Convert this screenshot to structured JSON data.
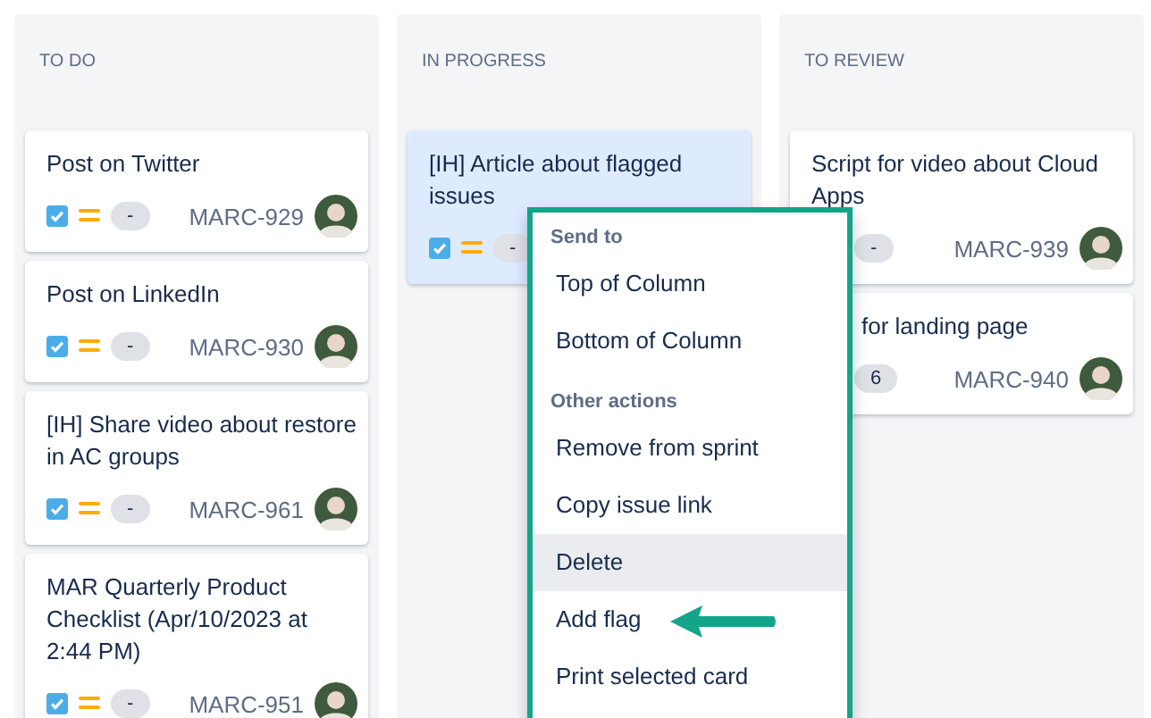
{
  "columns": [
    {
      "title": "TO DO",
      "cards": [
        {
          "title": "Post on Twitter",
          "done": true,
          "estimate": "-",
          "key": "MARC-929",
          "avatar": true,
          "selected": false
        },
        {
          "title": "Post on LinkedIn",
          "done": true,
          "estimate": "-",
          "key": "MARC-930",
          "avatar": true,
          "selected": false
        },
        {
          "title": "[IH] Share video about restore in AC groups",
          "done": true,
          "estimate": "-",
          "key": "MARC-961",
          "avatar": true,
          "selected": false
        },
        {
          "title": "MAR Quarterly Product Checklist (Apr/10/2023 at 2:44 PM)",
          "done": true,
          "estimate": "-",
          "key": "MARC-951",
          "avatar": true,
          "selected": false
        }
      ]
    },
    {
      "title": "IN PROGRESS",
      "cards": [
        {
          "title": "[IH] Article about flagged issues",
          "done": true,
          "estimate": "-",
          "selected": true
        }
      ]
    },
    {
      "title": "TO REVIEW",
      "cards": [
        {
          "kind": "footer-hidden",
          "title": "Script for video about Cloud Apps",
          "estimate": "-",
          "key": "MARC-939",
          "avatar": true,
          "selected": false
        },
        {
          "kind": "left-hidden",
          "title": "for landing page",
          "estimate": "6",
          "key": "MARC-940",
          "avatar": true,
          "selected": false
        }
      ]
    }
  ],
  "context_menu": {
    "sections": [
      {
        "heading": "Send to",
        "items": [
          {
            "label": "Top of Column",
            "hovered": false
          },
          {
            "label": "Bottom of Column",
            "hovered": false
          }
        ]
      },
      {
        "heading": "Other actions",
        "items": [
          {
            "label": "Remove from sprint",
            "hovered": false
          },
          {
            "label": "Copy issue link",
            "hovered": false
          },
          {
            "label": "Delete",
            "hovered": true
          },
          {
            "label": "Add flag",
            "hovered": false,
            "pointer": true
          },
          {
            "label": "Print selected card",
            "hovered": false
          }
        ]
      }
    ]
  }
}
